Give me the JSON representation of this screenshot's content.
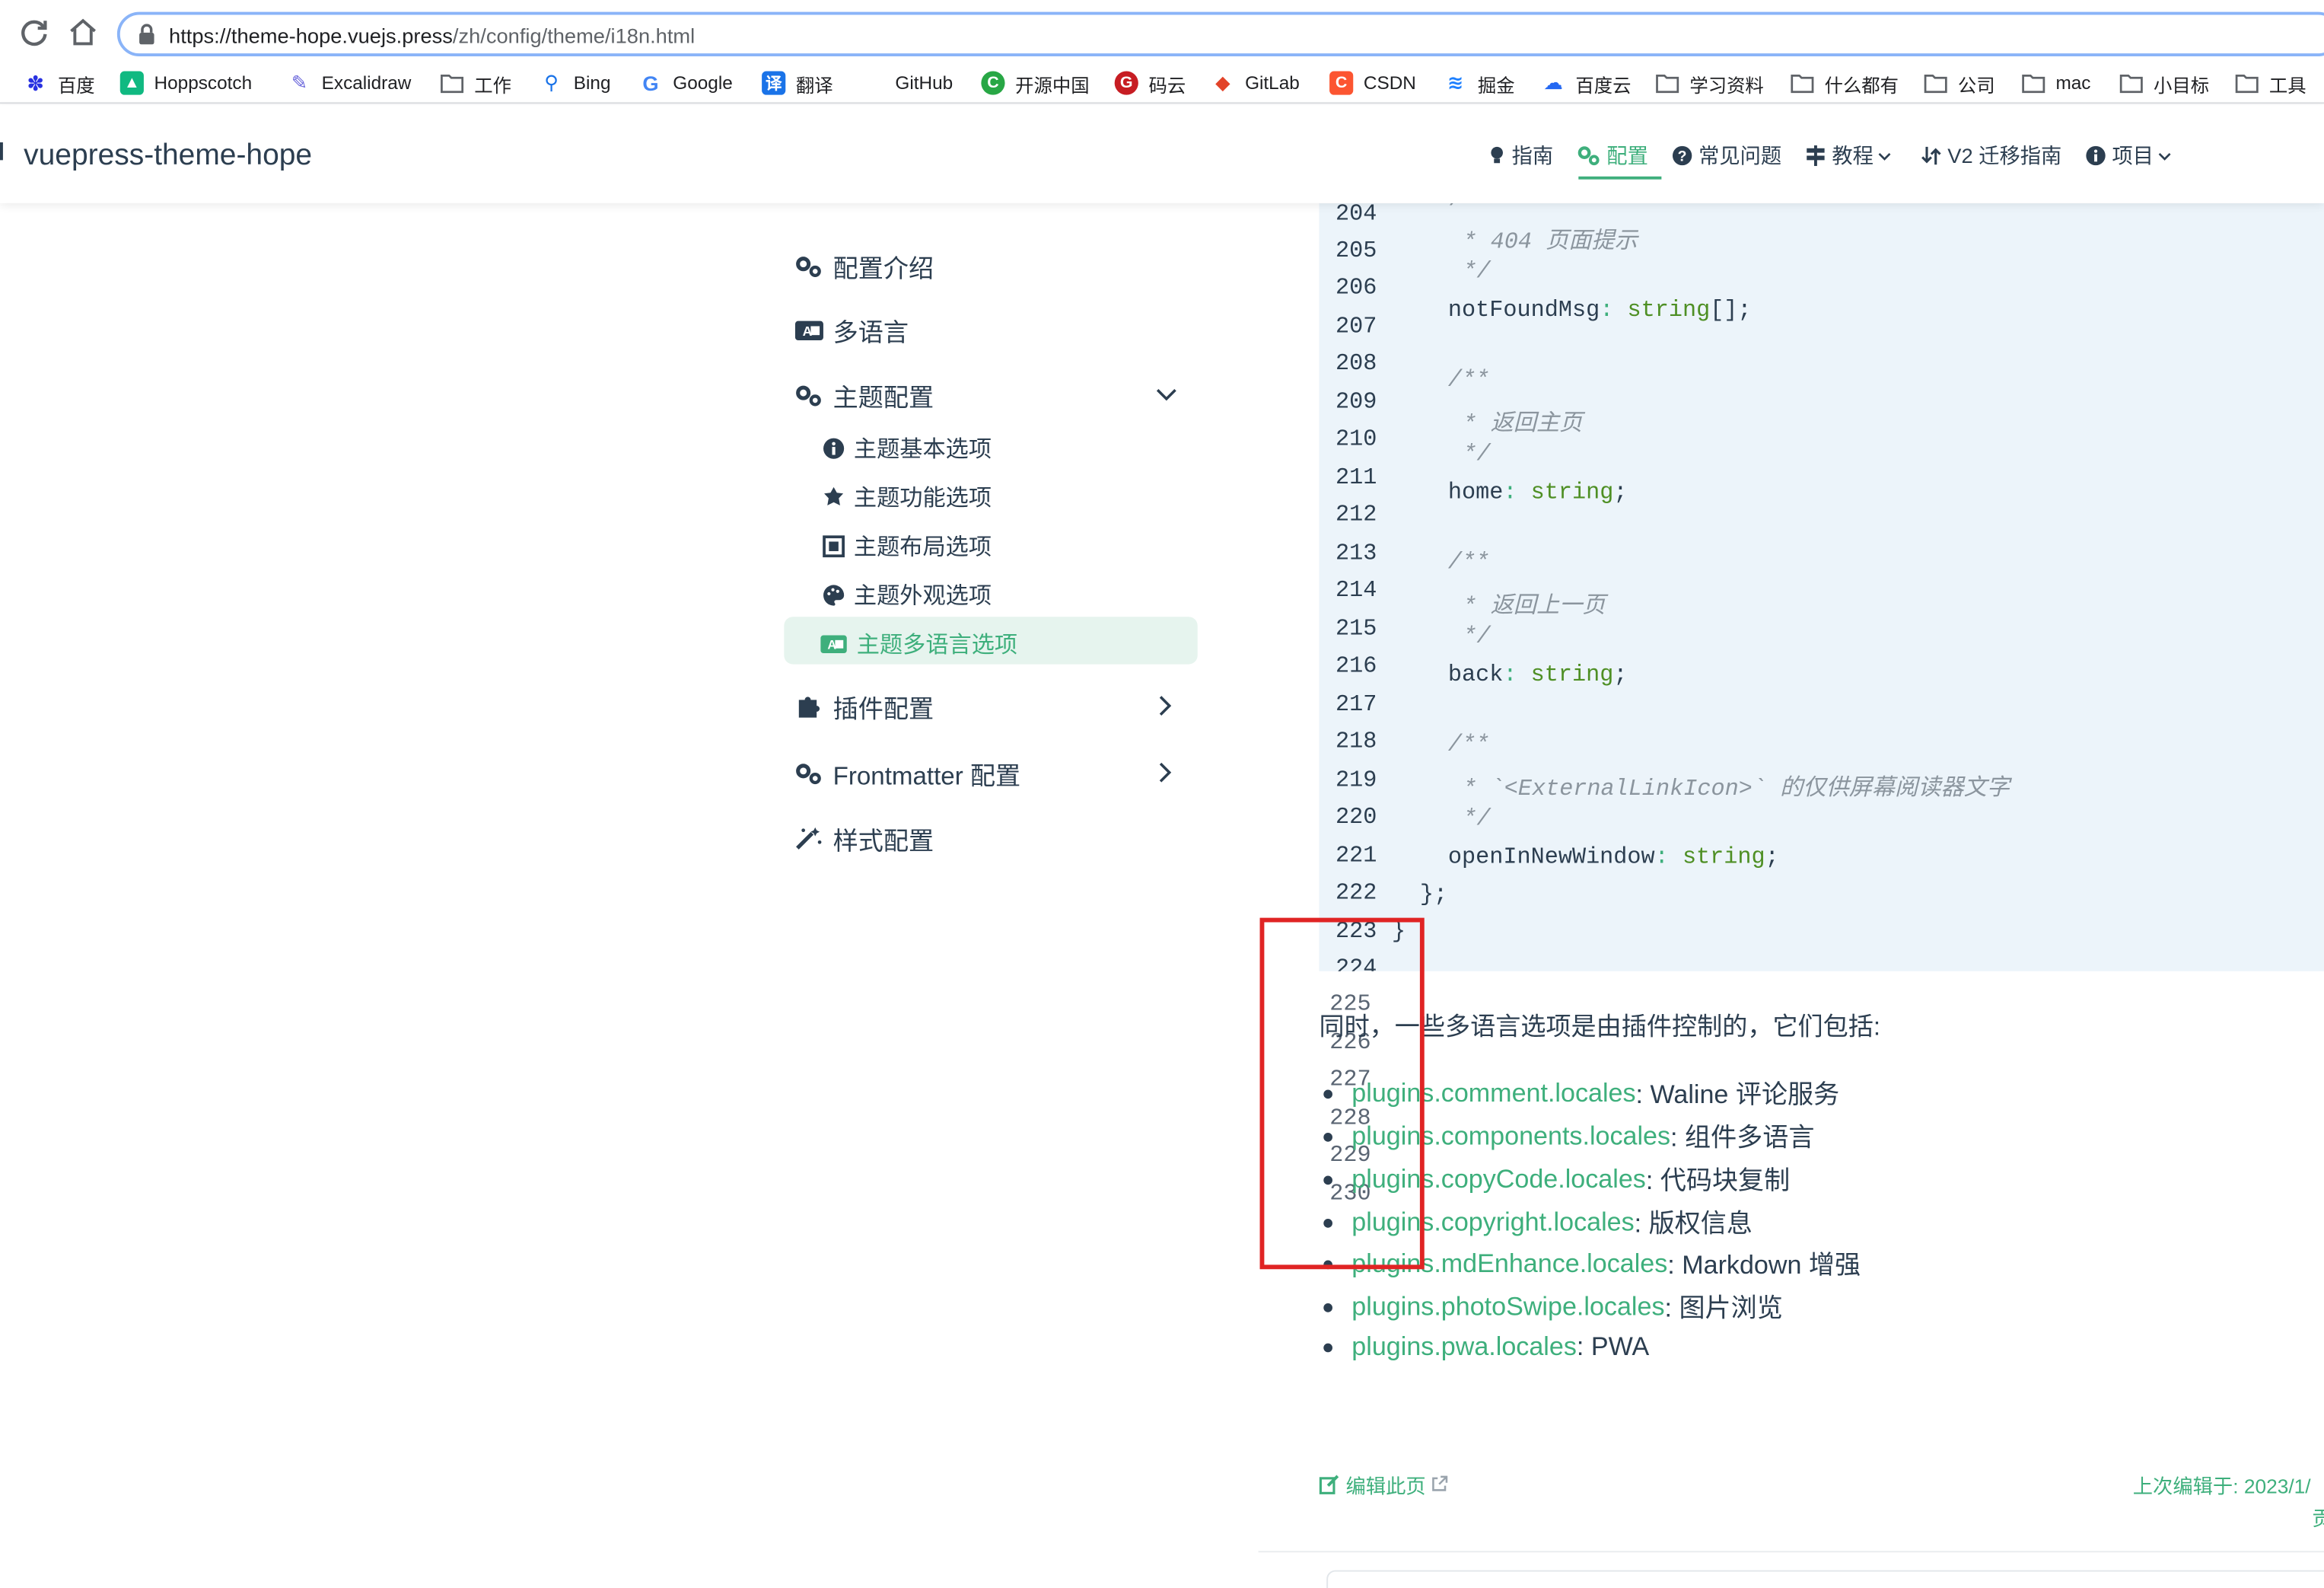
{
  "browser": {
    "url_host": "https://theme-hope.vuejs.press",
    "url_path": "/zh/config/theme/i18n.html",
    "bookmarks": [
      {
        "label": "百度",
        "icon": "baidu-paw-icon",
        "color": "#2932e1"
      },
      {
        "label": "Hoppscotch",
        "icon": "hoppscotch-icon",
        "color": "#10b981"
      },
      {
        "label": "Excalidraw",
        "icon": "excalidraw-pen-icon",
        "color": "#6965db"
      },
      {
        "label": "工作",
        "icon": "folder-icon",
        "color": "#5f6368"
      },
      {
        "label": "Bing",
        "icon": "bing-search-icon",
        "color": "#1a73e8"
      },
      {
        "label": "Google",
        "icon": "google-g-icon",
        "color": "#4285f4"
      },
      {
        "label": "翻译",
        "icon": "translate-icon",
        "color": "#1a73e8"
      },
      {
        "label": "GitHub",
        "icon": "github-icon",
        "color": "#202124"
      },
      {
        "label": "开源中国",
        "icon": "oschina-icon",
        "color": "#28a745"
      },
      {
        "label": "码云",
        "icon": "gitee-icon",
        "color": "#c71d23"
      },
      {
        "label": "GitLab",
        "icon": "gitlab-fox-icon",
        "color": "#e24329"
      },
      {
        "label": "CSDN",
        "icon": "csdn-icon",
        "color": "#fc5531"
      },
      {
        "label": "掘金",
        "icon": "juejin-icon",
        "color": "#1e80ff"
      },
      {
        "label": "百度云",
        "icon": "baidu-cloud-icon",
        "color": "#2468f2"
      },
      {
        "label": "学习资料",
        "icon": "folder-icon",
        "color": "#5f6368"
      },
      {
        "label": "什么都有",
        "icon": "folder-icon",
        "color": "#5f6368"
      },
      {
        "label": "公司",
        "icon": "folder-icon",
        "color": "#5f6368"
      },
      {
        "label": "mac",
        "icon": "folder-icon",
        "color": "#5f6368"
      },
      {
        "label": "小目标",
        "icon": "folder-icon",
        "color": "#5f6368"
      },
      {
        "label": "工具",
        "icon": "folder-icon",
        "color": "#5f6368"
      }
    ]
  },
  "site": {
    "brand": "vuepress-theme-hope",
    "accent": "#3eaf7c",
    "nav": [
      {
        "label": "指南",
        "icon": "lightbulb-icon"
      },
      {
        "label": "配置",
        "icon": "gears-icon",
        "active": true
      },
      {
        "label": "常见问题",
        "icon": "question-circle-icon"
      },
      {
        "label": "教程",
        "icon": "signs-icon",
        "dropdown": true
      },
      {
        "label": "V2 迁移指南",
        "icon": "migrate-icon"
      },
      {
        "label": "项目",
        "icon": "info-circle-icon",
        "dropdown": true
      }
    ]
  },
  "sidebar": {
    "items": [
      {
        "label": "配置介绍",
        "icon": "gears-icon"
      },
      {
        "label": "多语言",
        "icon": "language-icon"
      },
      {
        "label": "主题配置",
        "icon": "gears-icon",
        "expanded": true
      },
      {
        "label": "插件配置",
        "icon": "puzzle-icon"
      },
      {
        "label": "Frontmatter 配置",
        "icon": "gears-icon"
      },
      {
        "label": "样式配置",
        "icon": "magic-wand-icon"
      }
    ],
    "sub_items": [
      {
        "label": "主题基本选项",
        "icon": "info-circle-icon"
      },
      {
        "label": "主题功能选项",
        "icon": "star-badge-icon"
      },
      {
        "label": "主题布局选项",
        "icon": "layout-icon"
      },
      {
        "label": "主题外观选项",
        "icon": "palette-icon"
      },
      {
        "label": "主题多语言选项",
        "icon": "language-icon",
        "active": true
      }
    ]
  },
  "code": {
    "line_numbers": [
      "204",
      "205",
      "206",
      "207",
      "208",
      "209",
      "210",
      "211",
      "212",
      "213",
      "214",
      "215",
      "216",
      "217",
      "218",
      "219",
      "220",
      "221",
      "222",
      "223",
      "224"
    ],
    "lines": {
      "l204": "/",
      "l205": "* 404 页面提示",
      "l206": "*/",
      "l207_prop": "notFoundMsg",
      "l207_type": "string",
      "l207_rest": "[];",
      "l209": "/**",
      "l210": "* 返回主页",
      "l211": "*/",
      "l212_prop": "home",
      "l212_type": "string",
      "l214": "/**",
      "l215": "* 返回上一页",
      "l216": "*/",
      "l217_prop": "back",
      "l217_type": "string",
      "l219": "/**",
      "l220": "* `<ExternalLinkIcon>` 的仅供屏幕阅读器文字",
      "l221": "*/",
      "l222_prop": "openInNewWindow",
      "l222_type": "string",
      "close_inner": "};",
      "close_outer": "}",
      "colon": ":",
      "semi": ";"
    },
    "overflow_numbers": [
      "225",
      "226",
      "227",
      "228",
      "229",
      "230"
    ]
  },
  "content": {
    "paragraph": "同时，一些多语言选项是由插件控制的，它们包括:",
    "list": [
      {
        "link": "plugins.comment.locales",
        "desc": ": Waline 评论服务"
      },
      {
        "link": "plugins.components.locales",
        "desc": ": 组件多语言"
      },
      {
        "link": "plugins.copyCode.locales",
        "desc": ": 代码块复制"
      },
      {
        "link": "plugins.copyright.locales",
        "desc": ": 版权信息"
      },
      {
        "link": "plugins.mdEnhance.locales",
        "desc": ": Markdown 增强"
      },
      {
        "link": "plugins.photoSwipe.locales",
        "desc": ": 图片浏览"
      },
      {
        "link": "plugins.pwa.locales",
        "desc": ": PWA"
      }
    ],
    "edit_link": "编辑此页",
    "last_edited": "上次编辑于: 2023/1/",
    "contributors": "贡"
  },
  "annotation": {
    "highlight_color": "#e02424"
  }
}
